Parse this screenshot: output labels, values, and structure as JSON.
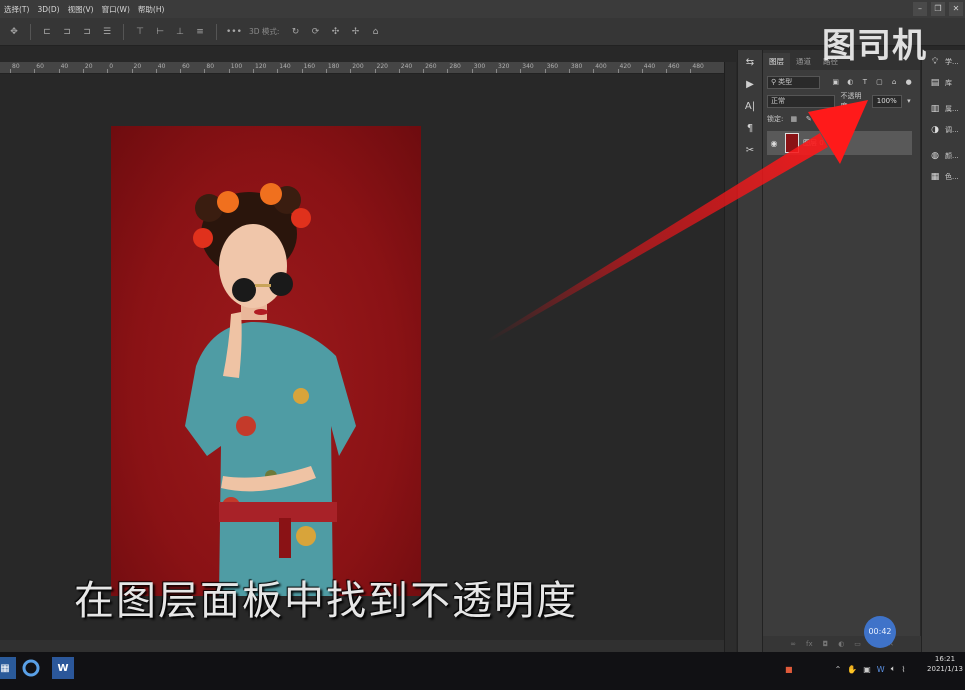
{
  "menu": [
    "选择(T)",
    "3D(D)",
    "视图(V)",
    "窗口(W)",
    "帮助(H)"
  ],
  "options_bar": {
    "mode_3d_label": "3D 模式:"
  },
  "ruler_ticks": [
    "80",
    "60",
    "40",
    "20",
    "0",
    "20",
    "40",
    "60",
    "80",
    "100",
    "120",
    "140",
    "160",
    "180",
    "200",
    "220",
    "240",
    "260",
    "280",
    "300",
    "320",
    "340",
    "360",
    "380",
    "400",
    "420",
    "440",
    "460",
    "480"
  ],
  "layers_panel": {
    "tabs": [
      "图层",
      "通道",
      "路径"
    ],
    "filter_label": "类型",
    "blend_mode": "正常",
    "opacity_label": "不透明度:",
    "opacity_value": "100%",
    "lock_label": "锁定:",
    "layer_name": "图层 0"
  },
  "right_panel": [
    {
      "icon": "lightbulb-icon",
      "label": "学..."
    },
    {
      "icon": "library-icon",
      "label": "库"
    },
    {
      "icon": "properties-icon",
      "label": "属..."
    },
    {
      "icon": "adjust-icon",
      "label": "调..."
    },
    {
      "icon": "color-icon",
      "label": "颜..."
    },
    {
      "icon": "swatch-icon",
      "label": "色..."
    }
  ],
  "watermark": "图司机",
  "subtitle": "在图层面板中找到不透明度",
  "timer": "00:42",
  "clock": {
    "time": "16:21",
    "date": "2021/1/13"
  },
  "colors": {
    "accent_arrow": "#e8141a",
    "photo_bg": "#8a1215",
    "timer_bg": "#3f73c9"
  }
}
